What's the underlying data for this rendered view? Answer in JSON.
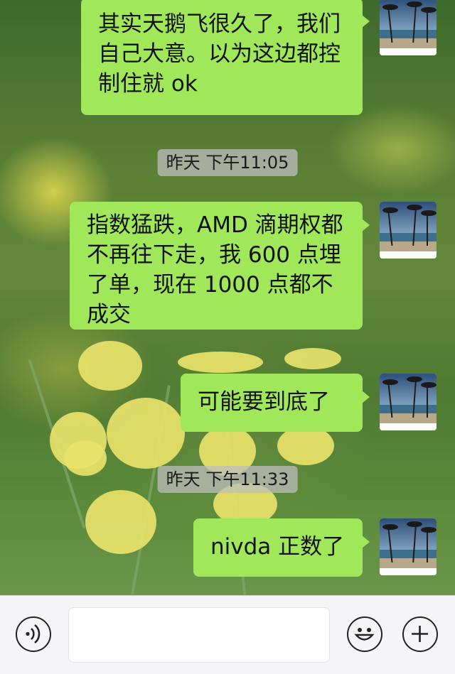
{
  "messages": [
    {
      "text": "其实天鹅飞很久了，我们自己大意。以为这边都控制住就 ok"
    },
    {
      "text": "指数猛跌，AMD 滴期权都不再往下走，我 600 点埋了单，现在 1000 点都不成交"
    },
    {
      "text": "可能要到底了"
    },
    {
      "text": "nivda 正数了"
    }
  ],
  "timestamps": [
    "昨天 下午11:05",
    "昨天 下午11:33"
  ],
  "input": {
    "value": "",
    "placeholder": ""
  },
  "icons": {
    "voice": "voice-icon",
    "emoji": "emoji-icon",
    "add": "plus-icon",
    "avatar": "beach-palm-avatar"
  },
  "colors": {
    "bubble": "#a0e75a",
    "timestamp_bg": "#bebebe",
    "toolbar": "#f5f5f7"
  }
}
